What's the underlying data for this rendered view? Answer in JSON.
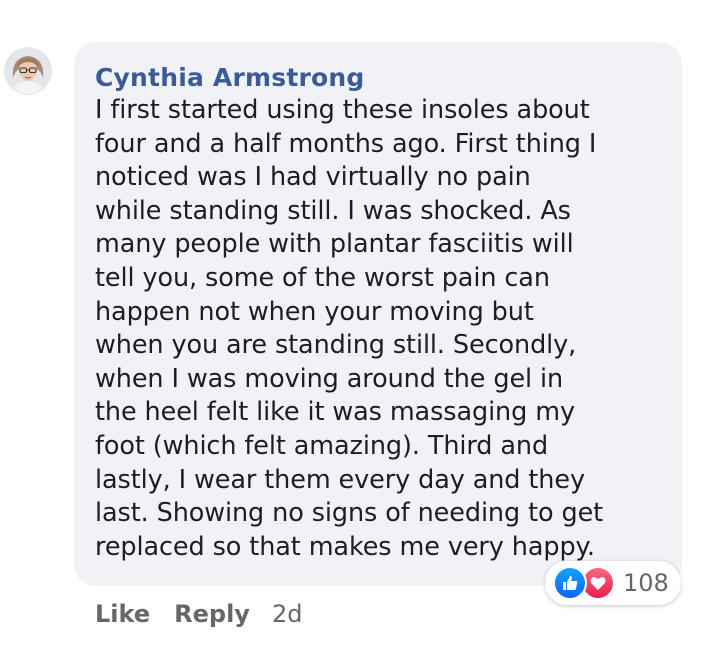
{
  "comment": {
    "author": "Cynthia Armstrong",
    "text": "I first started using these insoles about\nfour and a half months ago. First thing I\nnoticed was I had virtually no pain\nwhile standing still. I was shocked. As\nmany people with plantar fasciitis will\ntell you, some of the worst pain can\nhappen not when your moving but\nwhen you are standing still. Secondly,\nwhen I was moving around the gel in\nthe heel felt like it was massaging my\nfoot (which felt amazing). Third and\nlastly, I wear them every day and they\nlast. Showing no signs of needing to get\nreplaced so that makes me very happy."
  },
  "reactions": {
    "icons": [
      "like-icon",
      "love-icon"
    ],
    "count": "108"
  },
  "actions": {
    "like_label": "Like",
    "reply_label": "Reply",
    "timestamp": "2d"
  },
  "colors": {
    "author_name": "#3a5a98",
    "bubble_background": "#f0f2f5",
    "like_blue": "#0866ff",
    "love_red": "#e61e4d",
    "meta_gray": "#65676b"
  }
}
